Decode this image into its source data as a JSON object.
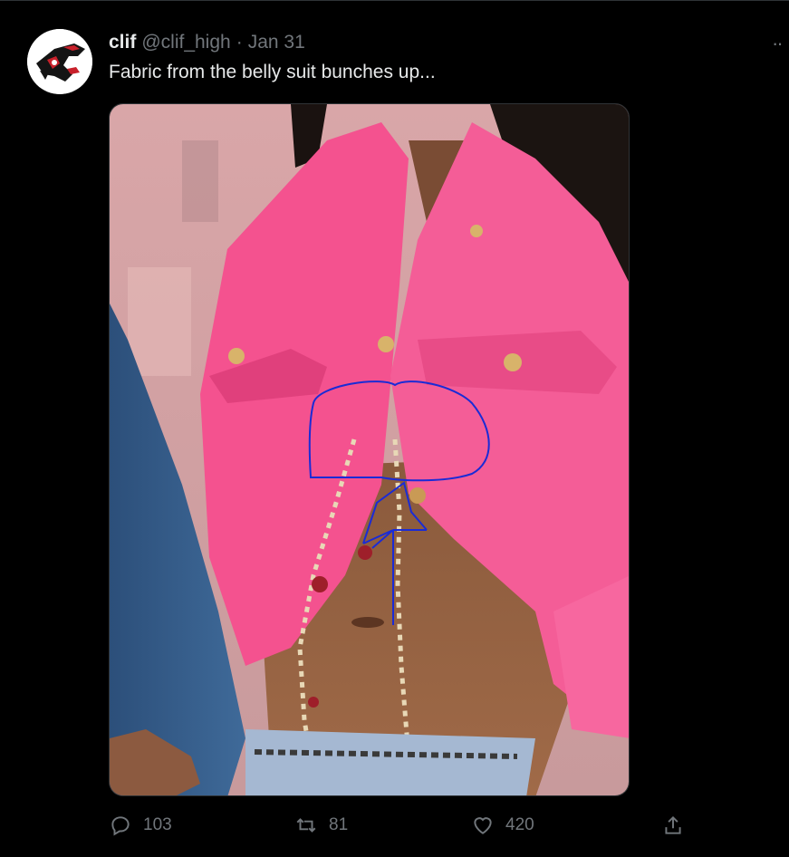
{
  "tweet": {
    "name": "clif",
    "handle": "@clif_high",
    "separator": "·",
    "date": "Jan 31",
    "text": "Fabric from the belly suit bunches up...",
    "more_label": "··",
    "avatar_icon": "raven-logo-icon",
    "media_description_icon": "photo-image"
  },
  "actions": {
    "reply_count": "103",
    "retweet_count": "81",
    "like_count": "420"
  },
  "colors": {
    "background": "#000000",
    "text": "#e7e9ea",
    "muted": "#71767b",
    "jacket_pink": "#f4528f",
    "annotation_blue": "#1a2bd6"
  }
}
